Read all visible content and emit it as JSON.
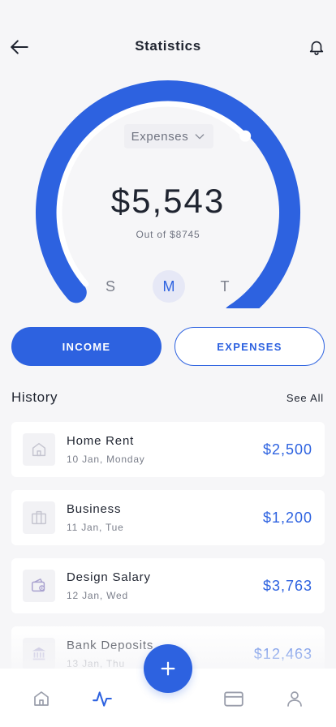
{
  "header": {
    "title": "Statistics",
    "back_icon": "arrow-left-icon",
    "notification_icon": "bell-icon"
  },
  "gauge": {
    "progress_fraction": 0.634,
    "dropdown_label": "Expenses",
    "amount": "$5,543",
    "subtitle": "Out of $8745",
    "color": "#2d62e0"
  },
  "days": [
    {
      "label": "S",
      "active": false
    },
    {
      "label": "M",
      "active": true
    },
    {
      "label": "T",
      "active": false
    }
  ],
  "toggle": {
    "income_label": "INCOME",
    "expenses_label": "EXPENSES"
  },
  "history": {
    "title": "History",
    "see_all": "See All",
    "items": [
      {
        "title": "Home Rent",
        "date": "10 Jan, Monday",
        "amount": "$2,500",
        "icon": "home-icon"
      },
      {
        "title": "Business",
        "date": "11 Jan, Tue",
        "amount": "$1,200",
        "icon": "briefcase-icon"
      },
      {
        "title": "Design Salary",
        "date": "12 Jan, Wed",
        "amount": "$3,763",
        "icon": "wallet-icon"
      },
      {
        "title": "Bank Deposits",
        "date": "13 Jan, Thu",
        "amount": "$12,463",
        "icon": "bank-icon"
      }
    ]
  },
  "nav": {
    "items": [
      "home-icon",
      "activity-icon",
      "add-icon",
      "card-icon",
      "profile-icon"
    ],
    "active": "activity-icon"
  }
}
